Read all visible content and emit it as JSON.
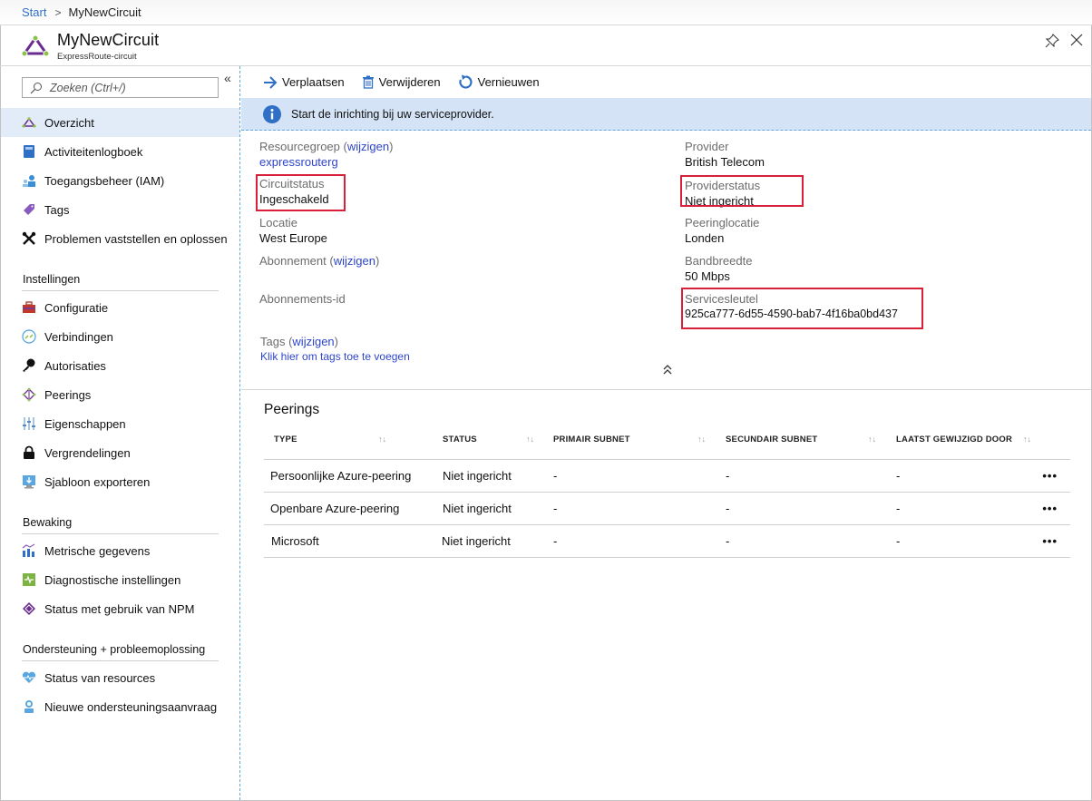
{
  "breadcrumb": {
    "root": "Start",
    "separator": ">",
    "current": "MyNewCircuit"
  },
  "header": {
    "title": "MyNewCircuit",
    "subtitle": "ExpressRoute-circuit",
    "pin_icon": "pin-icon",
    "close_icon": "close-icon"
  },
  "sidebar": {
    "search_placeholder": "Zoeken (Ctrl+/)",
    "collapse_label": "«",
    "items_top": [
      {
        "label": "Overzicht",
        "icon": "expressroute-icon",
        "active": true
      },
      {
        "label": "Activiteitenlogboek",
        "icon": "activity-log-icon"
      },
      {
        "label": "Toegangsbeheer (IAM)",
        "icon": "iam-icon"
      },
      {
        "label": "Tags",
        "icon": "tag-icon"
      },
      {
        "label": "Problemen vaststellen en oplossen",
        "icon": "wrench-icon"
      }
    ],
    "sections": [
      {
        "title": "Instellingen",
        "items": [
          {
            "label": "Configuratie",
            "icon": "toolbox-icon"
          },
          {
            "label": "Verbindingen",
            "icon": "connections-icon"
          },
          {
            "label": "Autorisaties",
            "icon": "key-icon"
          },
          {
            "label": "Peerings",
            "icon": "peerings-icon"
          },
          {
            "label": "Eigenschappen",
            "icon": "properties-icon"
          },
          {
            "label": "Vergrendelingen",
            "icon": "lock-icon"
          },
          {
            "label": "Sjabloon exporteren",
            "icon": "export-template-icon"
          }
        ]
      },
      {
        "title": "Bewaking",
        "items": [
          {
            "label": "Metrische gegevens",
            "icon": "metrics-icon"
          },
          {
            "label": "Diagnostische instellingen",
            "icon": "diagnostics-icon"
          },
          {
            "label": "Status met gebruik van NPM",
            "icon": "npm-icon"
          }
        ]
      },
      {
        "title": "Ondersteuning + probleemoplossing",
        "items": [
          {
            "label": "Status van resources",
            "icon": "heart-icon"
          },
          {
            "label": "Nieuwe ondersteuningsaanvraag",
            "icon": "support-icon"
          }
        ]
      }
    ]
  },
  "toolbar": {
    "move": "Verplaatsen",
    "delete": "Verwijderen",
    "refresh": "Vernieuwen"
  },
  "info_bar": {
    "message": "Start de inrichting bij uw serviceprovider."
  },
  "essentials": {
    "resource_group": {
      "label": "Resourcegroep",
      "change": "wijzigen",
      "value": "expressrouterg"
    },
    "circuit_status": {
      "label": "Circuitstatus",
      "value": "Ingeschakeld"
    },
    "location": {
      "label": "Locatie",
      "value": "West Europe"
    },
    "subscription": {
      "label": "Abonnement",
      "change": "wijzigen",
      "value": ""
    },
    "subscription_id": {
      "label": "Abonnements-id",
      "value": ""
    },
    "tags": {
      "label": "Tags",
      "change": "wijzigen",
      "add": "Klik hier om tags toe te voegen"
    },
    "provider": {
      "label": "Provider",
      "value": "British Telecom"
    },
    "provider_status": {
      "label": "Providerstatus",
      "value": "Niet ingericht"
    },
    "peering_location": {
      "label": "Peeringlocatie",
      "value": "Londen"
    },
    "bandwidth": {
      "label": "Bandbreedte",
      "value": "50 Mbps"
    },
    "service_key": {
      "label": "Servicesleutel",
      "value": "925ca777-6d55-4590-bab7-4f16ba0bd437"
    },
    "highlight_color": "#d8203a"
  },
  "peerings": {
    "title": "Peerings",
    "columns": [
      "TYPE",
      "STATUS",
      "PRIMAIR SUBNET",
      "SECUNDAIR SUBNET",
      "LAATST GEWIJZIGD DOOR"
    ],
    "sort_glyph": "↑↓",
    "more_glyph": "•••",
    "rows": [
      {
        "type": "Persoonlijke Azure-peering",
        "status": "Niet ingericht",
        "primary": "-",
        "secondary": "-",
        "modified_by": "-"
      },
      {
        "type": "Openbare Azure-peering",
        "status": "Niet ingericht",
        "primary": "-",
        "secondary": "-",
        "modified_by": "-"
      },
      {
        "type": "Microsoft",
        "status": "Niet ingericht",
        "primary": "-",
        "secondary": "-",
        "modified_by": "-"
      }
    ]
  },
  "colors": {
    "link": "#2e45c8",
    "accent": "#2f6fc6",
    "info_bg": "#d5e3f7",
    "active_nav": "#e2ecf9"
  }
}
